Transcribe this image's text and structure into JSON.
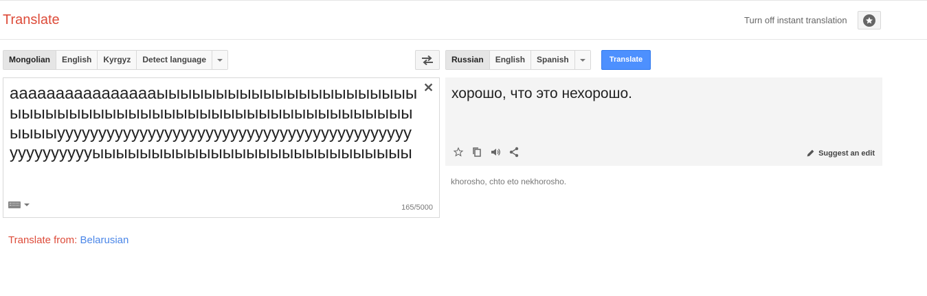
{
  "header": {
    "app_title": "Translate",
    "instant_toggle_label": "Turn off instant translation"
  },
  "source_langs": [
    "Mongolian",
    "English",
    "Kyrgyz",
    "Detect language"
  ],
  "target_langs": [
    "Russian",
    "English",
    "Spanish"
  ],
  "translate_button": "Translate",
  "source": {
    "text": "aaaaaaaaaaaaaaaaыыыыыыыыыыыыыыыыыыыыыыыыыыыыыыыыыыыыыыыыыыыыыыыыыыыыыыыыыыыыуууууууууууууууууууууууууууууууууууууууууууууууууууууыыыыыыыыыыыыыыыыыыыыыыыыыыы",
    "char_count": "165/5000"
  },
  "result": {
    "text": "хорошо, что это нехорошо.",
    "suggest_edit_label": "Suggest an edit",
    "transliteration": "khorosho, chto eto nekhorosho."
  },
  "detected": {
    "prefix": "Translate from: ",
    "language": "Belarusian"
  },
  "colors": {
    "brand_red": "#dd4b39",
    "translate_blue": "#4d90fe",
    "link_blue": "#4a86e8"
  },
  "icons": [
    "star-icon",
    "swap-icon",
    "close-icon",
    "keyboard-icon",
    "copy-icon",
    "speaker-icon",
    "share-icon",
    "pencil-icon"
  ]
}
